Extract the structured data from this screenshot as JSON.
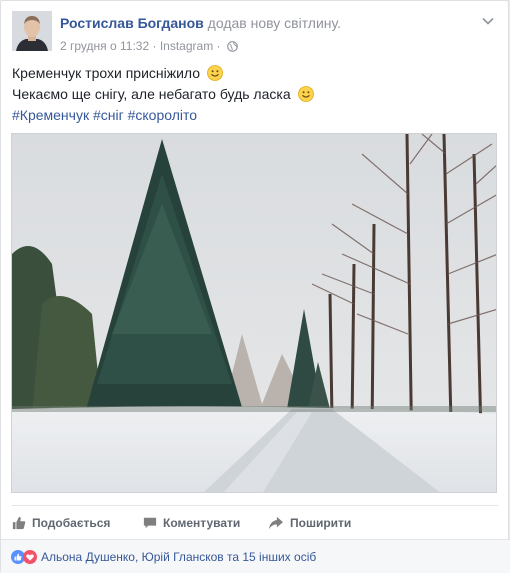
{
  "post": {
    "author_name": "Ростислав Богданов",
    "action_text": "додав нову світлину.",
    "timestamp": "2 грудня о 11:32",
    "separator": "·",
    "source": "Instagram",
    "text_line_1": "Кременчук трохи присніжило",
    "text_line_2": "Чекаємо ще снігу, але небагато будь ласка",
    "hashtags": [
      "#Кременчук",
      "#сніг",
      "#скороліто"
    ]
  },
  "actions": {
    "like_label": "Подобається",
    "comment_label": "Коментувати",
    "share_label": "Поширити"
  },
  "reactions": {
    "summary": "Альона Душенко, Юрій Глансков та 15 інших осіб"
  },
  "colors": {
    "link_blue": "#365899",
    "muted": "#90949c",
    "like_blue": "#5890ff",
    "love_red": "#f25268"
  },
  "icons": {
    "privacy": "globe-icon",
    "menu": "chevron-down-icon",
    "like": "thumbs-up-icon",
    "comment": "speech-bubble-icon",
    "share": "share-arrow-icon"
  }
}
